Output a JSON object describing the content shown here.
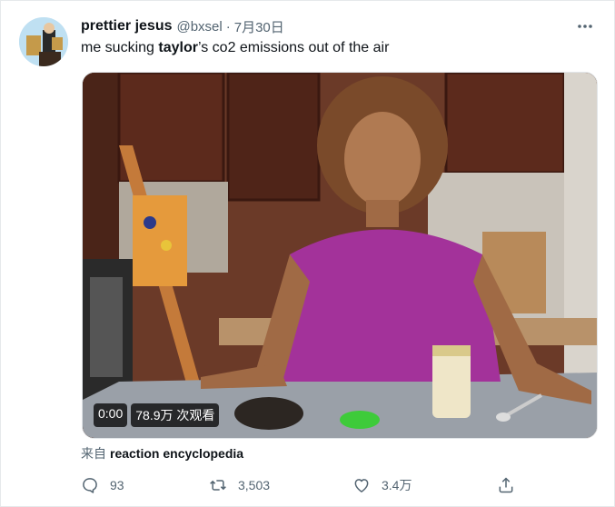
{
  "tweet": {
    "author": {
      "display_name": "prettier jesus",
      "handle": "@bxsel",
      "separator": "·",
      "date": "7月30日"
    },
    "text": {
      "before": "me sucking ",
      "bold": "taylor",
      "after": "’s co2 emissions out of the air"
    },
    "media": {
      "timestamp": "0:00",
      "views": "78.9万 次观看"
    },
    "source": {
      "prefix": "来自",
      "name": "reaction encyclopedia"
    },
    "actions": {
      "reply_count": "93",
      "retweet_count": "3,503",
      "like_count": "3.4万"
    },
    "icons": {
      "more": "more-horizontal-icon",
      "reply": "reply-icon",
      "retweet": "retweet-icon",
      "like": "heart-icon",
      "share": "share-icon"
    },
    "colors": {
      "text_primary": "#0f1419",
      "text_secondary": "#536471",
      "border": "#e6e9eb"
    }
  }
}
